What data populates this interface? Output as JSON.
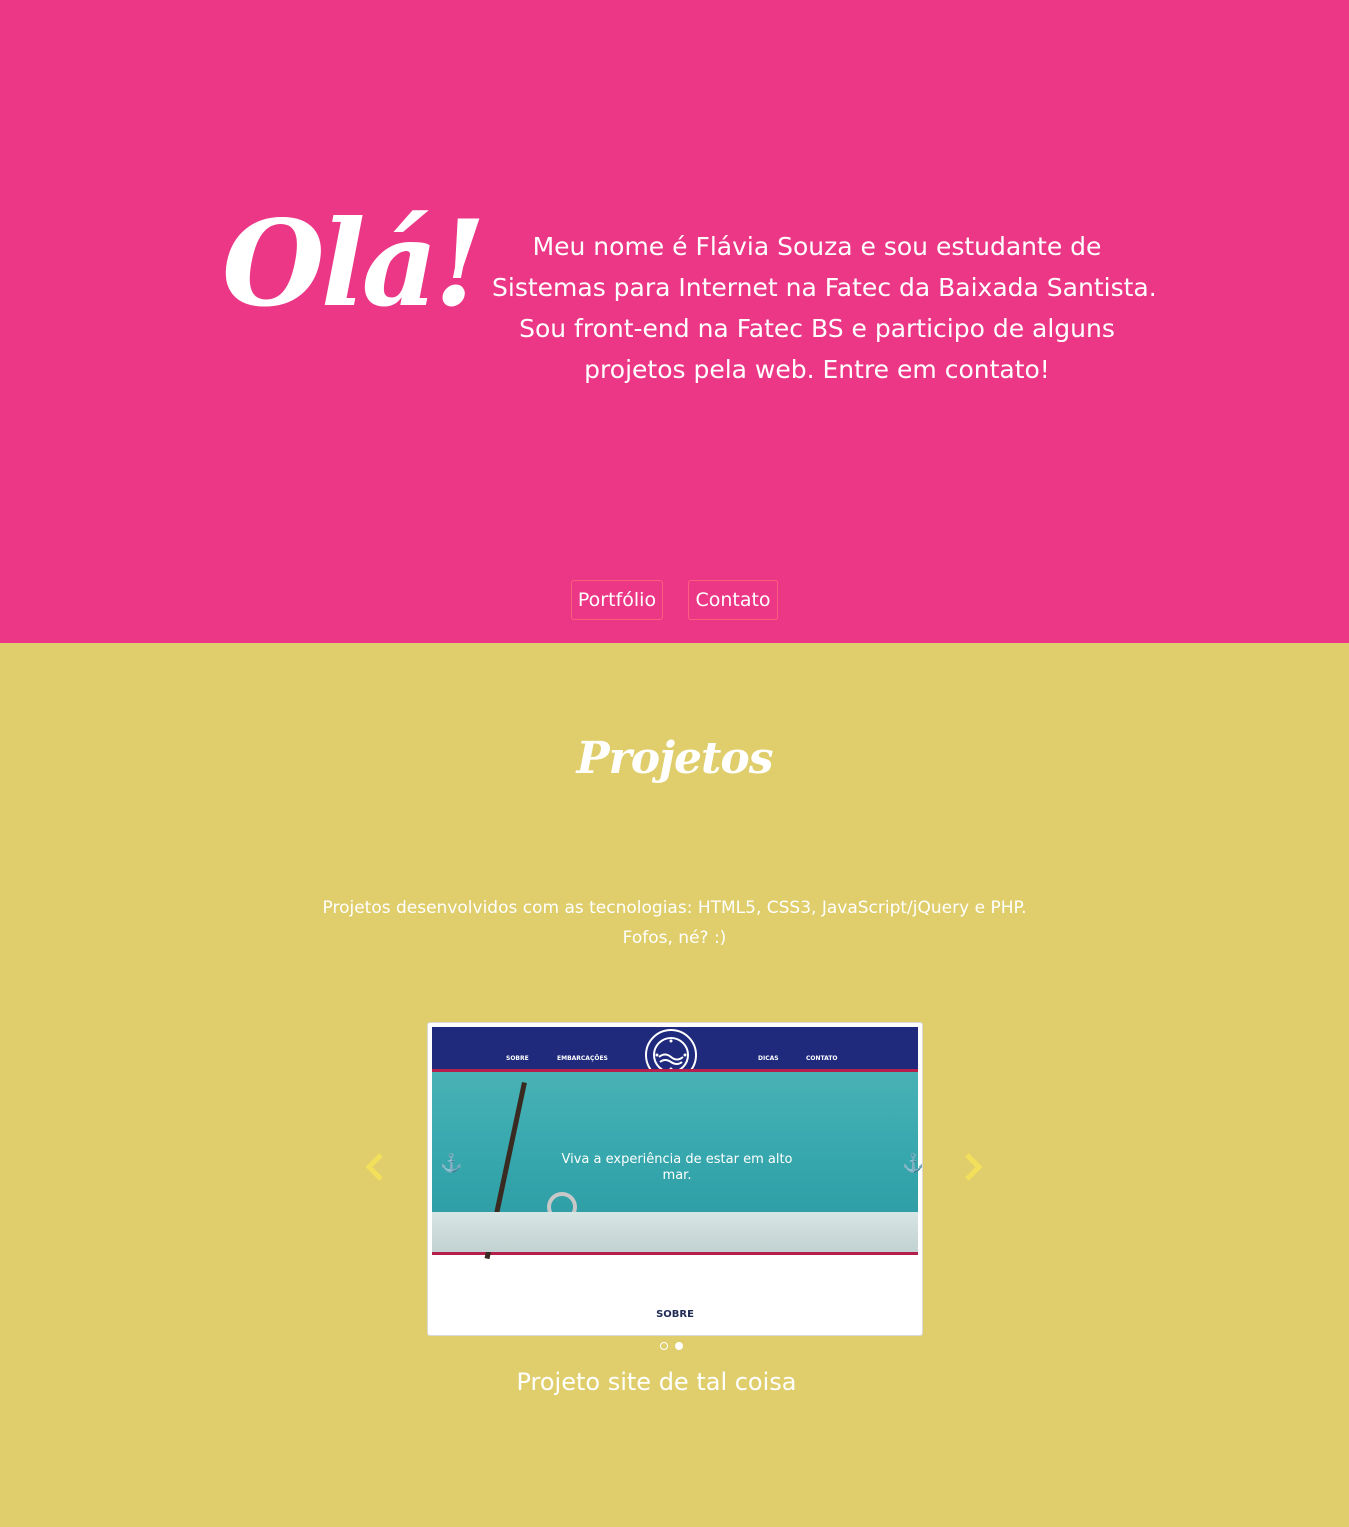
{
  "hero": {
    "greeting": "Olá!",
    "intro_lines": [
      "Meu nome é Flávia Souza e sou estudante de",
      "Sistemas para Internet na Fatec da Baixada Santista.",
      "Sou front-end na Fatec BS e participo de alguns",
      "projetos pela web. Entre em contato!"
    ],
    "buttons": {
      "portfolio": "Portfólio",
      "contato": "Contato"
    },
    "background": "#ec3787"
  },
  "projects": {
    "title": "Projetos",
    "description_lines": [
      "Projetos desenvolvidos com as tecnologias: HTML5, CSS3, JavaScript/jQuery e PHP.",
      "Fofos, né? :)"
    ],
    "background": "#e0ce6c",
    "carousel": {
      "prev_icon": "chevron-left-icon",
      "next_icon": "chevron-right-icon",
      "slide": {
        "nav_items": [
          "SOBRE",
          "EMBARCAÇÕES",
          "DICAS",
          "CONTATO"
        ],
        "tagline_lines": [
          "Viva a experiência de estar em alto",
          "mar."
        ],
        "anchor_icon": "⚓",
        "section_label": "SOBRE"
      },
      "indicators": {
        "count": 2,
        "active_index": 1
      },
      "caption": "Projeto site de tal coisa"
    }
  }
}
